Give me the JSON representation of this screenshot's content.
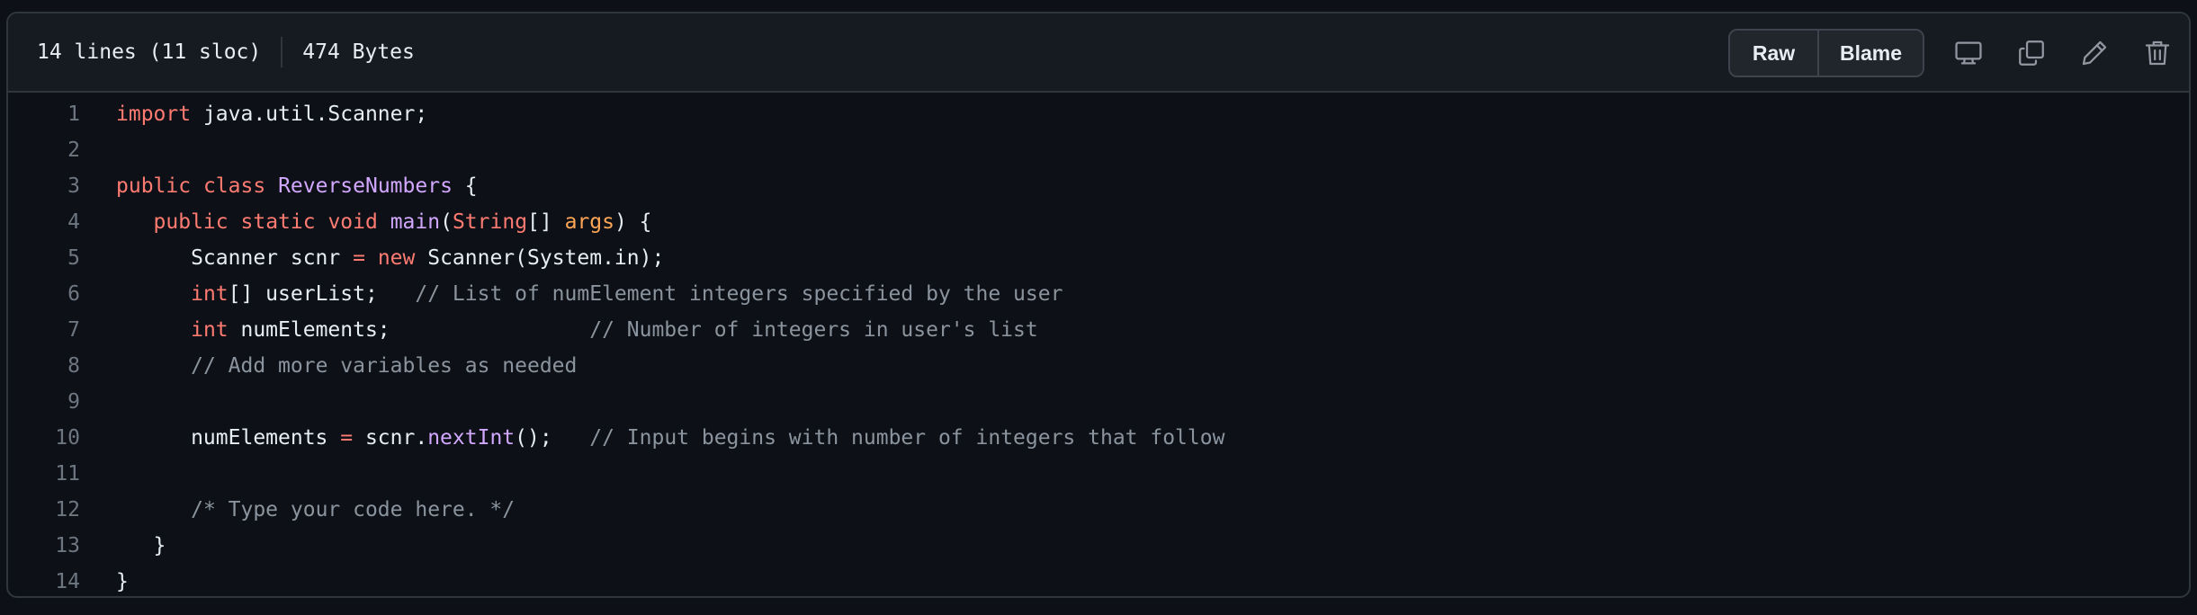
{
  "header": {
    "lines_info": "14 lines (11 sloc)",
    "size_info": "474 Bytes",
    "raw_label": "Raw",
    "blame_label": "Blame"
  },
  "icons": {
    "display": "desktop-icon",
    "copy": "copy-icon",
    "edit": "pencil-icon",
    "delete": "trash-icon"
  },
  "colors": {
    "background": "#0d1117",
    "header_bg": "#161b22",
    "border": "#30363d",
    "text": "#e6edf3",
    "keyword": "#ff7b72",
    "class_name": "#d2a8ff",
    "parameter": "#ffa657",
    "comment": "#8b949e",
    "line_number": "#6e7681"
  },
  "code": {
    "language": "java",
    "lines": [
      {
        "n": "1",
        "tokens": [
          {
            "t": "import",
            "k": "kw"
          },
          {
            "t": " java.util.Scanner;"
          }
        ]
      },
      {
        "n": "2",
        "tokens": []
      },
      {
        "n": "3",
        "tokens": [
          {
            "t": "public",
            "k": "kw"
          },
          {
            "t": " "
          },
          {
            "t": "class",
            "k": "kw"
          },
          {
            "t": " "
          },
          {
            "t": "ReverseNumbers",
            "k": "cls"
          },
          {
            "t": " {"
          }
        ]
      },
      {
        "n": "4",
        "tokens": [
          {
            "t": "   "
          },
          {
            "t": "public",
            "k": "kw"
          },
          {
            "t": " "
          },
          {
            "t": "static",
            "k": "kw"
          },
          {
            "t": " "
          },
          {
            "t": "void",
            "k": "kw"
          },
          {
            "t": " "
          },
          {
            "t": "main",
            "k": "fn"
          },
          {
            "t": "("
          },
          {
            "t": "String",
            "k": "kw"
          },
          {
            "t": "[] "
          },
          {
            "t": "args",
            "k": "param"
          },
          {
            "t": ") {"
          }
        ]
      },
      {
        "n": "5",
        "tokens": [
          {
            "t": "      Scanner scnr "
          },
          {
            "t": "=",
            "k": "op"
          },
          {
            "t": " "
          },
          {
            "t": "new",
            "k": "kw"
          },
          {
            "t": " Scanner(System.in);"
          }
        ]
      },
      {
        "n": "6",
        "tokens": [
          {
            "t": "      "
          },
          {
            "t": "int",
            "k": "kw"
          },
          {
            "t": "[] userList;   "
          },
          {
            "t": "// List of numElement integers specified by the user",
            "k": "cm"
          }
        ]
      },
      {
        "n": "7",
        "tokens": [
          {
            "t": "      "
          },
          {
            "t": "int",
            "k": "kw"
          },
          {
            "t": " numElements;                "
          },
          {
            "t": "// Number of integers in user's list",
            "k": "cm"
          }
        ]
      },
      {
        "n": "8",
        "tokens": [
          {
            "t": "      "
          },
          {
            "t": "// Add more variables as needed",
            "k": "cm"
          }
        ]
      },
      {
        "n": "9",
        "tokens": []
      },
      {
        "n": "10",
        "tokens": [
          {
            "t": "      numElements "
          },
          {
            "t": "=",
            "k": "op"
          },
          {
            "t": " scnr."
          },
          {
            "t": "nextInt",
            "k": "fn"
          },
          {
            "t": "();   "
          },
          {
            "t": "// Input begins with number of integers that follow",
            "k": "cm"
          }
        ]
      },
      {
        "n": "11",
        "tokens": []
      },
      {
        "n": "12",
        "tokens": [
          {
            "t": "      "
          },
          {
            "t": "/* Type your code here. */",
            "k": "cm"
          }
        ]
      },
      {
        "n": "13",
        "tokens": [
          {
            "t": "   }"
          }
        ]
      },
      {
        "n": "14",
        "tokens": [
          {
            "t": "}"
          }
        ]
      }
    ]
  }
}
